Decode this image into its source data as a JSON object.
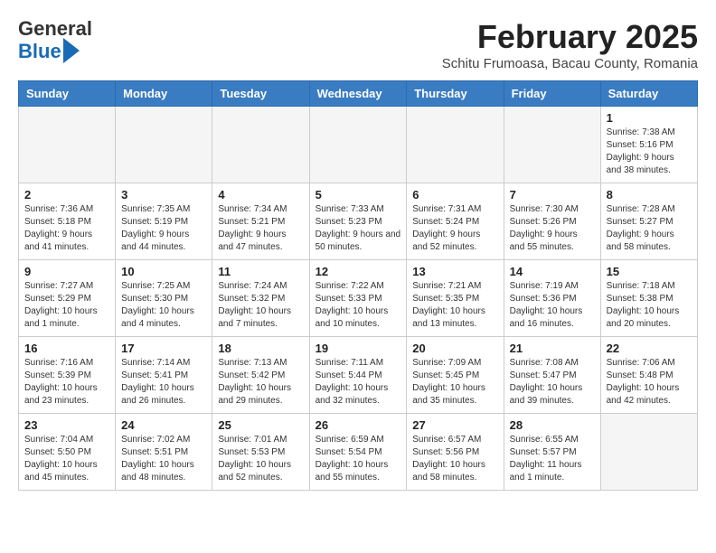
{
  "header": {
    "logo_line1": "General",
    "logo_line2": "Blue",
    "month_title": "February 2025",
    "subtitle": "Schitu Frumoasa, Bacau County, Romania"
  },
  "weekdays": [
    "Sunday",
    "Monday",
    "Tuesday",
    "Wednesday",
    "Thursday",
    "Friday",
    "Saturday"
  ],
  "weeks": [
    [
      {
        "day": "",
        "info": ""
      },
      {
        "day": "",
        "info": ""
      },
      {
        "day": "",
        "info": ""
      },
      {
        "day": "",
        "info": ""
      },
      {
        "day": "",
        "info": ""
      },
      {
        "day": "",
        "info": ""
      },
      {
        "day": "1",
        "info": "Sunrise: 7:38 AM\nSunset: 5:16 PM\nDaylight: 9 hours and 38 minutes."
      }
    ],
    [
      {
        "day": "2",
        "info": "Sunrise: 7:36 AM\nSunset: 5:18 PM\nDaylight: 9 hours and 41 minutes."
      },
      {
        "day": "3",
        "info": "Sunrise: 7:35 AM\nSunset: 5:19 PM\nDaylight: 9 hours and 44 minutes."
      },
      {
        "day": "4",
        "info": "Sunrise: 7:34 AM\nSunset: 5:21 PM\nDaylight: 9 hours and 47 minutes."
      },
      {
        "day": "5",
        "info": "Sunrise: 7:33 AM\nSunset: 5:23 PM\nDaylight: 9 hours and 50 minutes."
      },
      {
        "day": "6",
        "info": "Sunrise: 7:31 AM\nSunset: 5:24 PM\nDaylight: 9 hours and 52 minutes."
      },
      {
        "day": "7",
        "info": "Sunrise: 7:30 AM\nSunset: 5:26 PM\nDaylight: 9 hours and 55 minutes."
      },
      {
        "day": "8",
        "info": "Sunrise: 7:28 AM\nSunset: 5:27 PM\nDaylight: 9 hours and 58 minutes."
      }
    ],
    [
      {
        "day": "9",
        "info": "Sunrise: 7:27 AM\nSunset: 5:29 PM\nDaylight: 10 hours and 1 minute."
      },
      {
        "day": "10",
        "info": "Sunrise: 7:25 AM\nSunset: 5:30 PM\nDaylight: 10 hours and 4 minutes."
      },
      {
        "day": "11",
        "info": "Sunrise: 7:24 AM\nSunset: 5:32 PM\nDaylight: 10 hours and 7 minutes."
      },
      {
        "day": "12",
        "info": "Sunrise: 7:22 AM\nSunset: 5:33 PM\nDaylight: 10 hours and 10 minutes."
      },
      {
        "day": "13",
        "info": "Sunrise: 7:21 AM\nSunset: 5:35 PM\nDaylight: 10 hours and 13 minutes."
      },
      {
        "day": "14",
        "info": "Sunrise: 7:19 AM\nSunset: 5:36 PM\nDaylight: 10 hours and 16 minutes."
      },
      {
        "day": "15",
        "info": "Sunrise: 7:18 AM\nSunset: 5:38 PM\nDaylight: 10 hours and 20 minutes."
      }
    ],
    [
      {
        "day": "16",
        "info": "Sunrise: 7:16 AM\nSunset: 5:39 PM\nDaylight: 10 hours and 23 minutes."
      },
      {
        "day": "17",
        "info": "Sunrise: 7:14 AM\nSunset: 5:41 PM\nDaylight: 10 hours and 26 minutes."
      },
      {
        "day": "18",
        "info": "Sunrise: 7:13 AM\nSunset: 5:42 PM\nDaylight: 10 hours and 29 minutes."
      },
      {
        "day": "19",
        "info": "Sunrise: 7:11 AM\nSunset: 5:44 PM\nDaylight: 10 hours and 32 minutes."
      },
      {
        "day": "20",
        "info": "Sunrise: 7:09 AM\nSunset: 5:45 PM\nDaylight: 10 hours and 35 minutes."
      },
      {
        "day": "21",
        "info": "Sunrise: 7:08 AM\nSunset: 5:47 PM\nDaylight: 10 hours and 39 minutes."
      },
      {
        "day": "22",
        "info": "Sunrise: 7:06 AM\nSunset: 5:48 PM\nDaylight: 10 hours and 42 minutes."
      }
    ],
    [
      {
        "day": "23",
        "info": "Sunrise: 7:04 AM\nSunset: 5:50 PM\nDaylight: 10 hours and 45 minutes."
      },
      {
        "day": "24",
        "info": "Sunrise: 7:02 AM\nSunset: 5:51 PM\nDaylight: 10 hours and 48 minutes."
      },
      {
        "day": "25",
        "info": "Sunrise: 7:01 AM\nSunset: 5:53 PM\nDaylight: 10 hours and 52 minutes."
      },
      {
        "day": "26",
        "info": "Sunrise: 6:59 AM\nSunset: 5:54 PM\nDaylight: 10 hours and 55 minutes."
      },
      {
        "day": "27",
        "info": "Sunrise: 6:57 AM\nSunset: 5:56 PM\nDaylight: 10 hours and 58 minutes."
      },
      {
        "day": "28",
        "info": "Sunrise: 6:55 AM\nSunset: 5:57 PM\nDaylight: 11 hours and 1 minute."
      },
      {
        "day": "",
        "info": ""
      }
    ]
  ]
}
